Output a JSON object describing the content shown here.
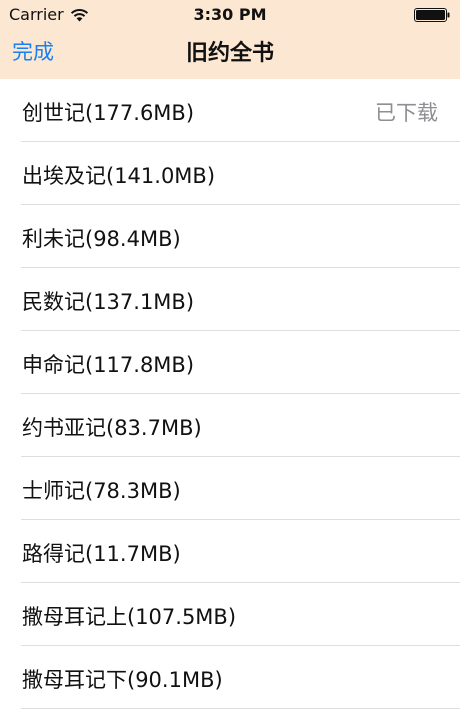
{
  "status_bar": {
    "carrier": "Carrier",
    "time": "3:30 PM"
  },
  "nav": {
    "done_label": "完成",
    "title": "旧约全书"
  },
  "books": [
    {
      "label": "创世记(177.6MB)",
      "status": "已下载"
    },
    {
      "label": "出埃及记(141.0MB)",
      "status": ""
    },
    {
      "label": "利未记(98.4MB)",
      "status": ""
    },
    {
      "label": "民数记(137.1MB)",
      "status": ""
    },
    {
      "label": "申命记(117.8MB)",
      "status": ""
    },
    {
      "label": "约书亚记(83.7MB)",
      "status": ""
    },
    {
      "label": "士师记(78.3MB)",
      "status": ""
    },
    {
      "label": "路得记(11.7MB)",
      "status": ""
    },
    {
      "label": "撒母耳记上(107.5MB)",
      "status": ""
    },
    {
      "label": "撒母耳记下(90.1MB)",
      "status": ""
    }
  ],
  "colors": {
    "header_bg": "#fbe7d2",
    "accent": "#1a7ff0",
    "status_text": "#8e8e93"
  }
}
